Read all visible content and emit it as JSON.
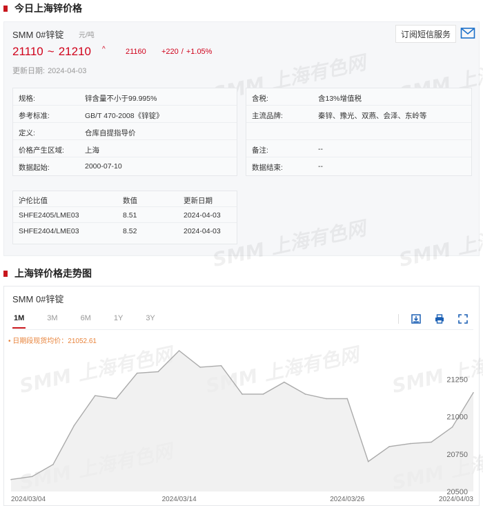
{
  "sections": {
    "price_title": "今日上海锌价格",
    "chart_title": "上海锌价格走势图"
  },
  "watermark": "SMM 上海有色网",
  "product": {
    "name": "SMM 0#锌锭",
    "unit": "元/吨",
    "subscribe_label": "订阅短信服务",
    "price_low": "21110",
    "tilde": "~",
    "price_high": "21210",
    "trend_arrow": "^",
    "average": "21160",
    "change": "+220",
    "change_sep": "/",
    "change_pct": "+1.05%",
    "updated_label": "更新日期:",
    "updated_date": "2024-04-03",
    "accent_color": "#d0021b"
  },
  "spec_left": [
    {
      "label": "规格:",
      "value": "锌含量不小于99.995%"
    },
    {
      "label": "参考标准:",
      "value": "GB/T 470-2008《锌锭》"
    },
    {
      "label": "定义:",
      "value": "仓库自提指导价"
    },
    {
      "label": "价格产生区域:",
      "value": "上海"
    },
    {
      "label": "数据起始:",
      "value": "2000-07-10"
    }
  ],
  "spec_right": [
    {
      "label": "含税:",
      "value": "含13%增值税"
    },
    {
      "label": "主流品牌:",
      "value": "秦锌、豫光、双燕、会泽、东岭等"
    },
    {
      "label": "",
      "value": ""
    },
    {
      "label": "备注:",
      "value": "--"
    },
    {
      "label": "数据结束:",
      "value": "--"
    }
  ],
  "ratio_table": {
    "headers": [
      "沪伦比值",
      "数值",
      "更新日期"
    ],
    "rows": [
      [
        "SHFE2405/LME03",
        "8.51",
        "2024-04-03"
      ],
      [
        "SHFE2404/LME03",
        "8.52",
        "2024-04-03"
      ]
    ]
  },
  "chart_panel": {
    "title": "SMM 0#锌锭",
    "tabs": [
      "1M",
      "3M",
      "6M",
      "1Y",
      "3Y"
    ],
    "active_tab": "1M",
    "avg_note": "• 日期段现货均价：21052.61",
    "tools": [
      "download-icon",
      "print-icon",
      "fullscreen-icon"
    ]
  },
  "chart_data": {
    "type": "area",
    "title": "",
    "xlabel": "",
    "ylabel": "",
    "x": [
      "2024/03/04",
      "2024/03/05",
      "2024/03/06",
      "2024/03/07",
      "2024/03/08",
      "2024/03/11",
      "2024/03/12",
      "2024/03/13",
      "2024/03/14",
      "2024/03/15",
      "2024/03/18",
      "2024/03/19",
      "2024/03/20",
      "2024/03/21",
      "2024/03/22",
      "2024/03/25",
      "2024/03/26",
      "2024/03/27",
      "2024/03/28",
      "2024/03/29",
      "2024/04/01",
      "2024/04/02",
      "2024/04/03"
    ],
    "values": [
      20580,
      20600,
      20680,
      20940,
      21140,
      21120,
      21290,
      21300,
      21440,
      21330,
      21340,
      21150,
      21150,
      21230,
      21150,
      21120,
      21120,
      20700,
      20800,
      20820,
      20830,
      20930,
      21160
    ],
    "x_tick_labels": [
      "2024/03/04",
      "2024/03/14",
      "2024/03/26",
      "2024/04/03"
    ],
    "y_ticks": [
      20500,
      20750,
      21000,
      21250
    ],
    "ylim": [
      20500,
      21500
    ],
    "line_color": "#aaaaaa",
    "fill_color": "#ececec",
    "grid": false
  }
}
